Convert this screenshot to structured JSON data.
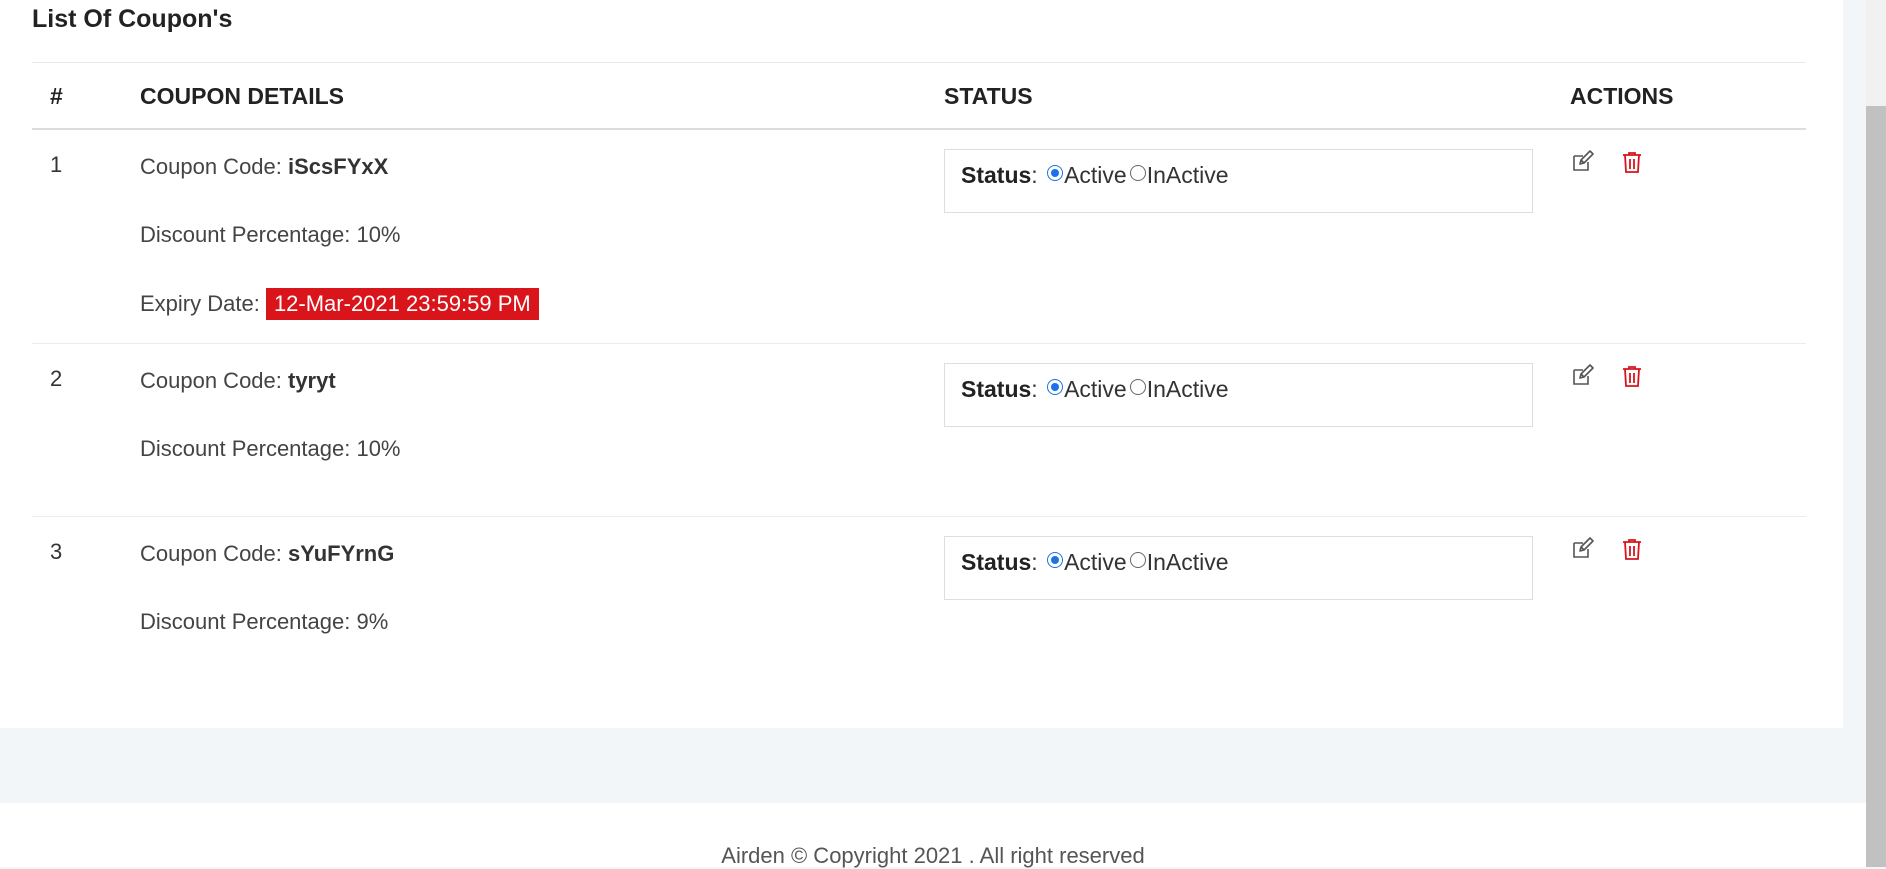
{
  "page": {
    "title": "List Of Coupon's"
  },
  "table": {
    "headers": {
      "num": "#",
      "details": "COUPON DETAILS",
      "status": "STATUS",
      "actions": "ACTIONS"
    }
  },
  "coupons": [
    {
      "num": "1",
      "code_label": "Coupon Code: ",
      "code": "iScsFYxX",
      "discount": "Discount Percentage: 10%",
      "expiry_label": "Expiry Date: ",
      "expiry": "12-Mar-2021 23:59:59 PM",
      "status_label": "Status",
      "status_sep": ":",
      "active_label": "Active",
      "inactive_label": "InActive",
      "status": "active"
    },
    {
      "num": "2",
      "code_label": "Coupon Code: ",
      "code": "tyryt",
      "discount": "Discount Percentage: 10%",
      "status_label": "Status",
      "status_sep": ":",
      "active_label": "Active",
      "inactive_label": "InActive",
      "status": "active"
    },
    {
      "num": "3",
      "code_label": "Coupon Code: ",
      "code": "sYuFYrnG",
      "discount": "Discount Percentage: 9%",
      "status_label": "Status",
      "status_sep": ":",
      "active_label": "Active",
      "inactive_label": "InActive",
      "status": "active"
    }
  ],
  "icons": {
    "edit": "edit-icon",
    "delete": "trash-icon"
  },
  "colors": {
    "expiry_badge": "#d9141b",
    "delete_icon": "#d9141b",
    "radio_checked": "#1a73e8"
  },
  "footer": {
    "text": "Airden © Copyright 2021 . All right reserved"
  }
}
